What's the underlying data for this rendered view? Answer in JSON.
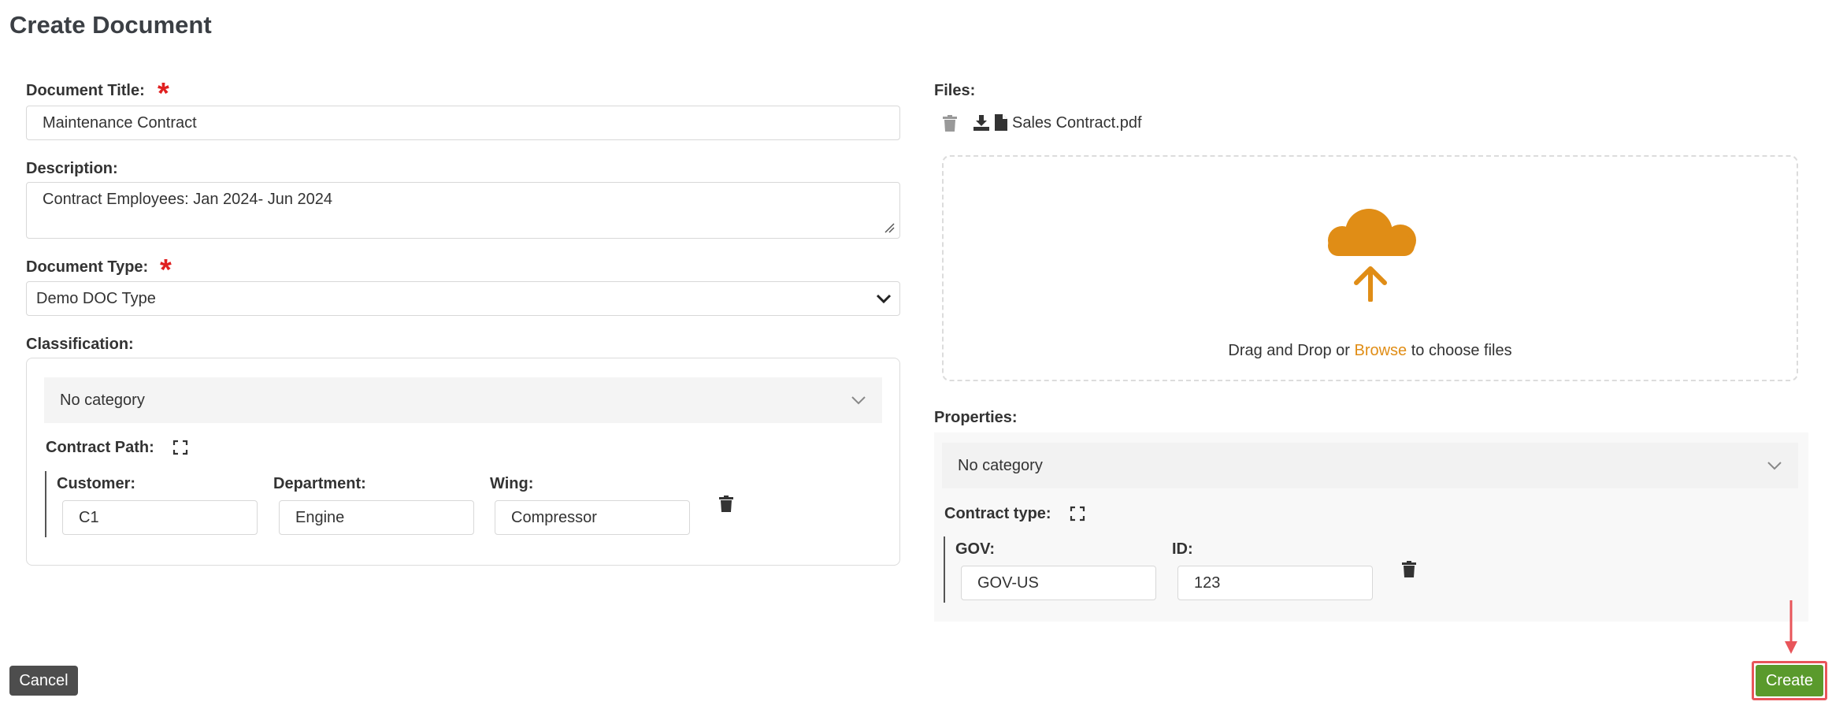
{
  "page": {
    "title": "Create Document"
  },
  "document_title": {
    "label": "Document Title:",
    "value": "Maintenance Contract",
    "required_mark": "*"
  },
  "description": {
    "label": "Description:",
    "value": "Contract Employees: Jan 2024- Jun 2024"
  },
  "document_type": {
    "label": "Document Type:",
    "value": "Demo DOC Type",
    "required_mark": "*"
  },
  "classification": {
    "label": "Classification:",
    "category_value": "No category",
    "path_label": "Contract Path:",
    "fields": [
      {
        "label": "Customer:",
        "value": "C1"
      },
      {
        "label": "Department:",
        "value": "Engine"
      },
      {
        "label": "Wing:",
        "value": "Compressor"
      }
    ]
  },
  "files": {
    "label": "Files:",
    "items": [
      {
        "name": "Sales Contract.pdf"
      }
    ],
    "dropzone": {
      "prefix": "Drag and Drop or",
      "link": "Browse",
      "suffix": "to choose files"
    }
  },
  "properties": {
    "label": "Properties:",
    "category_value": "No category",
    "type_label": "Contract type:",
    "fields": [
      {
        "label": "GOV:",
        "value": "GOV-US"
      },
      {
        "label": "ID:",
        "value": "123"
      }
    ]
  },
  "actions": {
    "cancel_label": "Cancel",
    "create_label": "Create"
  },
  "colors": {
    "accent": "#e08d16",
    "required": "#e02020",
    "create": "#5a9a2c",
    "highlight": "#e8555a",
    "cancel": "#4d4d4d"
  },
  "icons": [
    "asterisk-icon",
    "chevron-down-icon",
    "expand-icon",
    "trash-icon",
    "download-icon",
    "file-icon",
    "cloud-upload-icon",
    "arrow-down-icon"
  ]
}
